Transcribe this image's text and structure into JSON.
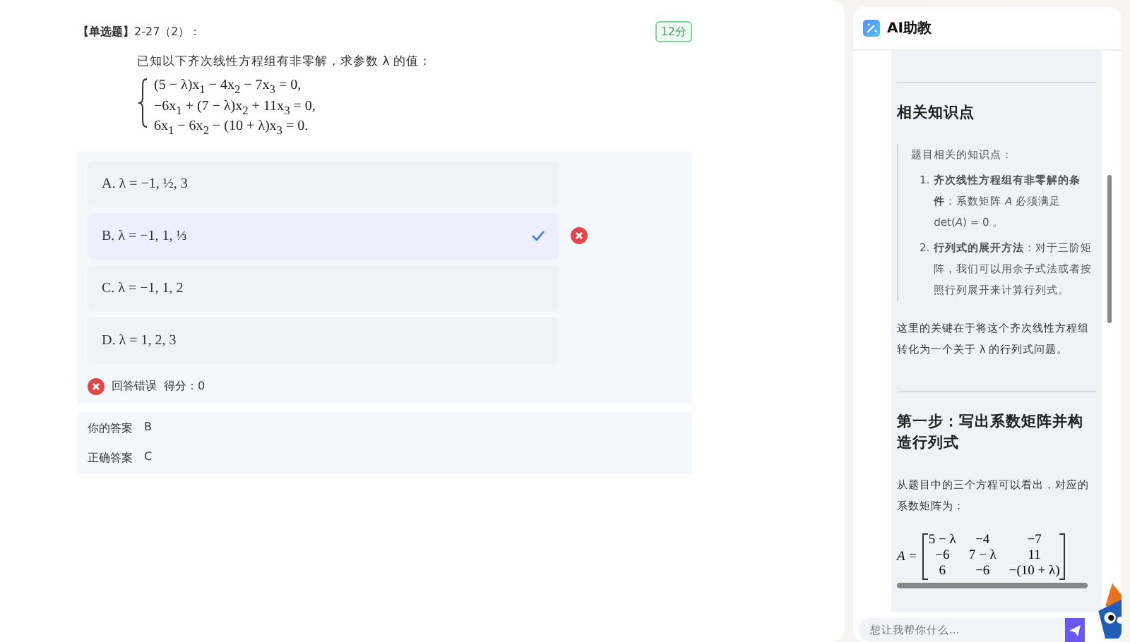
{
  "question": {
    "type_label": "【单选题】",
    "number": "2-27（2）：",
    "points": "12分",
    "prompt": "已知以下齐次线性方程组有非零解，求参数 λ 的值：",
    "equations": [
      "(5 − λ)x$_{1}$ − 4x$_{2}$ − 7x$_{3}$ = 0,",
      "−6x$_{1}$ + (7 − λ)x$_{2}$ + 11x$_{3}$ = 0,",
      "6x$_{1}$ − 6x$_{2}$ − (10 + λ)x$_{3}$ = 0."
    ]
  },
  "options": [
    {
      "label": "A. λ = −1, ½, 3",
      "selected": false
    },
    {
      "label": "B. λ = −1, 1, ⅓",
      "selected": true
    },
    {
      "label": "C. λ = −1, 1, 2",
      "selected": false
    },
    {
      "label": "D. λ = 1, 2, 3",
      "selected": false
    }
  ],
  "result": {
    "correct": false,
    "text": "回答错误",
    "score": "得分：0"
  },
  "answers": [
    {
      "label": "你的答案",
      "value": "B"
    },
    {
      "label": "正确答案",
      "value": "C"
    }
  ],
  "assistant": {
    "title": "AI助教",
    "input_placeholder": "想让我帮你什么...",
    "blocks": [
      {
        "kind": "divider"
      },
      {
        "kind": "heading",
        "text": "相关知识点"
      },
      {
        "kind": "quote",
        "intro": "题目相关的知识点：",
        "items": [
          {
            "marker": "1.",
            "text": "**齐次线性方程组有非零解的条件**：系数矩阵 *A* 必须满足 det(*A*) = 0 。"
          },
          {
            "marker": "2.",
            "text": "**行列式的展开方法**：对于三阶矩阵，我们可以用余子式法或者按照行列展开来计算行列式。"
          }
        ]
      },
      {
        "kind": "paragraph",
        "text": "这里的关键在于将这个齐次线性方程组转化为一个关于 λ 的行列式问题。"
      },
      {
        "kind": "divider"
      },
      {
        "kind": "heading",
        "text": "第一步：写出系数矩阵并构造行列式"
      },
      {
        "kind": "paragraph",
        "text": "从题目中的三个方程可以看出，对应的系数矩阵为："
      },
      {
        "kind": "matrix",
        "name": "A =",
        "rows": [
          [
            "5 − λ",
            "−4",
            "−7"
          ],
          [
            "−6",
            "7 − λ",
            "11"
          ],
          [
            "6",
            "−6",
            "−(10 + λ)"
          ]
        ]
      }
    ]
  }
}
